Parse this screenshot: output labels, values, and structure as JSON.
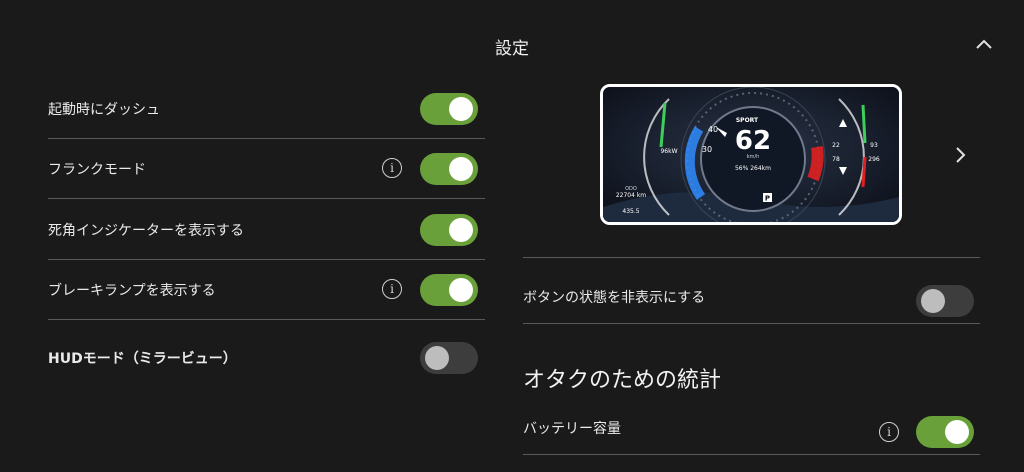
{
  "header": {
    "title": "設定"
  },
  "icons": {
    "collapse": "chevron-up-icon",
    "next": "chevron-right-icon",
    "info": "info-icon"
  },
  "colors": {
    "toggle_on": "#6aa03a",
    "toggle_off": "#3d3d3d",
    "background": "#1a1a1a",
    "accent_blue": "#2f8cff",
    "accent_red": "#e02020"
  },
  "left_settings": [
    {
      "label": "起動時にダッシュ",
      "state": "on",
      "info": false
    },
    {
      "label": "フランクモード",
      "state": "on",
      "info": true
    },
    {
      "label": "死角インジケーターを表示する",
      "state": "on",
      "info": false
    },
    {
      "label": "ブレーキランプを表示する",
      "state": "on",
      "info": true
    },
    {
      "label": "HUDモード（ミラービュー）",
      "state": "off",
      "info": false
    }
  ],
  "dashboard_preview": {
    "mode": "SPORT",
    "speed": "62",
    "speed_unit": "km/h",
    "battery": "56%  264km",
    "power": "96kW",
    "odo_label": "ODO",
    "odo": "22704 km",
    "trip": "435.5",
    "dial_left_ticks": [
      "40",
      "30"
    ],
    "right_values": [
      "22",
      "93",
      "78",
      "296"
    ],
    "gear": "P"
  },
  "right_settings": [
    {
      "label": "ボタンの状態を非表示にする",
      "state": "off",
      "info": false
    }
  ],
  "stats_section": {
    "title": "オタクのための統計",
    "items": [
      {
        "label": "バッテリー容量",
        "state": "on",
        "info": true
      }
    ]
  },
  "info_glyph": "i"
}
